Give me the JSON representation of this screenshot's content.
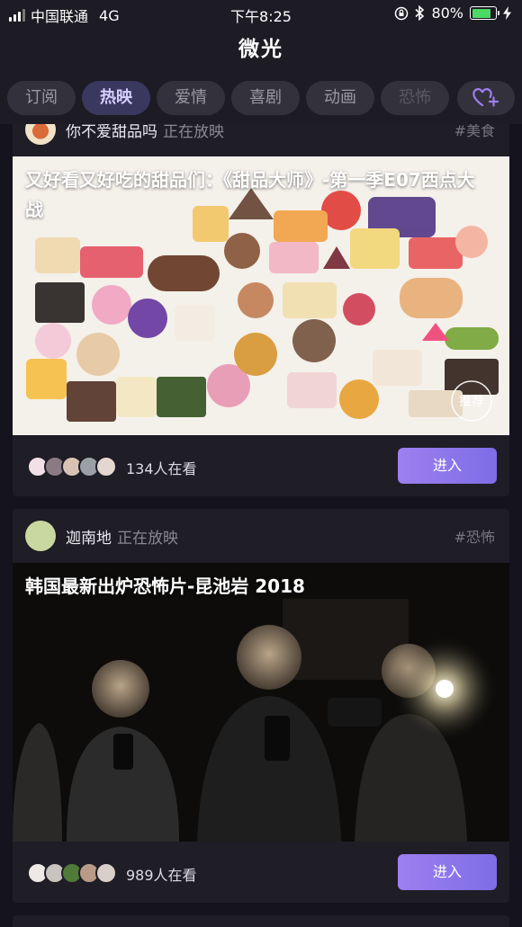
{
  "status_bar": {
    "carrier": "中国联通",
    "network": "4G",
    "time": "下午8:25",
    "battery": "80%",
    "battery_level": 0.8
  },
  "header": {
    "title": "微光"
  },
  "tabs": [
    {
      "label": "订阅",
      "active": false
    },
    {
      "label": "热映",
      "active": true
    },
    {
      "label": "爱情",
      "active": false
    },
    {
      "label": "喜剧",
      "active": false
    },
    {
      "label": "动画",
      "active": false
    },
    {
      "label": "恐怖",
      "active": false
    }
  ],
  "favorite_button": {
    "icon": "heart-plus-icon"
  },
  "cards": [
    {
      "user": "你不爱甜品吗",
      "state": "正在放映",
      "tag": "#美食",
      "caption": "又好看又好吃的甜品们：《甜品大师》-第一季E07西点大战",
      "viewers": "134人在看",
      "viewer_count": 134,
      "enter_label": "进入",
      "badge": "推荐"
    },
    {
      "user": "迦南地",
      "state": "正在放映",
      "tag": "#恐怖",
      "caption": "韩国最新出炉恐怖片-昆池岩 2018",
      "viewers": "989人在看",
      "viewer_count": 989,
      "enter_label": "进入"
    }
  ],
  "colors": {
    "background": "#15131d",
    "card": "#1f1d26",
    "accent": "#8b76ec",
    "active_tab": "#3b3860"
  }
}
